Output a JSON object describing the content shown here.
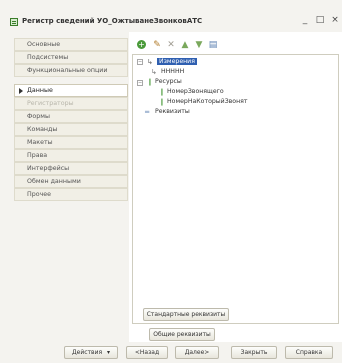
{
  "window": {
    "title": "Регистр сведений УО_ОжтыванеЗвонковАТС",
    "minimize_glyph": "_",
    "maximize_glyph": "□",
    "close_glyph": "×"
  },
  "sidebar": {
    "items": [
      {
        "label": "Основные",
        "state": "normal"
      },
      {
        "label": "Подсистемы",
        "state": "normal"
      },
      {
        "label": "Функциональные опции",
        "state": "normal"
      },
      {
        "label": "Данные",
        "state": "active"
      },
      {
        "label": "Регистраторы",
        "state": "disabled"
      },
      {
        "label": "Формы",
        "state": "normal"
      },
      {
        "label": "Команды",
        "state": "normal"
      },
      {
        "label": "Макеты",
        "state": "normal"
      },
      {
        "label": "Права",
        "state": "normal"
      },
      {
        "label": "Интерфейсы",
        "state": "normal"
      },
      {
        "label": "Обмен данными",
        "state": "normal"
      },
      {
        "label": "Прочее",
        "state": "normal"
      }
    ]
  },
  "toolbar": {
    "icons": [
      "add-icon",
      "edit-icon",
      "delete-icon",
      "move-up-icon",
      "move-down-icon",
      "document-icon"
    ]
  },
  "tree": {
    "dimensions_label": "Измерения",
    "dimension_child": "НННHН",
    "resources_label": "Ресурсы",
    "resource_1": "НомерЗвонящего",
    "resource_2": "НомерНаКоторыйЗвонят",
    "requisites_label": "Реквизиты"
  },
  "buttons": {
    "standard_requisites": "Стандартные реквизиты",
    "common_requisites": "Общие реквизиты",
    "actions": "Действия",
    "back": "<Назад",
    "next": "Далее>",
    "close": "Закрыть",
    "help": "Справка"
  },
  "colors": {
    "selection": "#2f5fb0",
    "resource_icon": "#4a9a3a",
    "window_bg": "#f4f3ef"
  }
}
